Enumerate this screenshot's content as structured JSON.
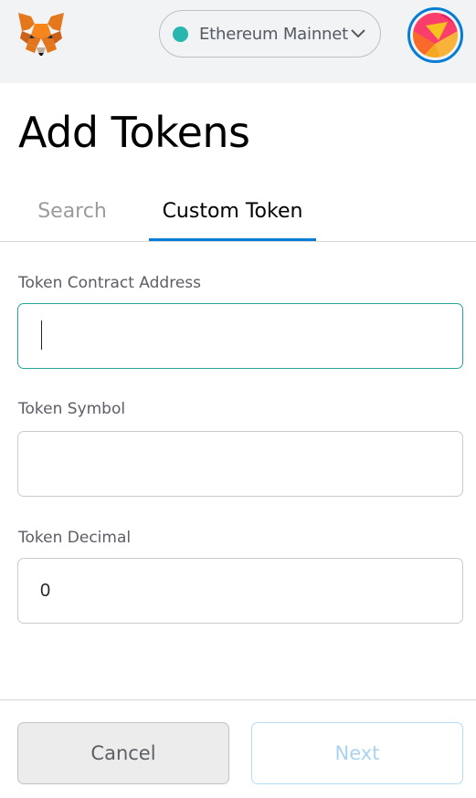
{
  "header": {
    "logo_icon": "metamask-fox-icon",
    "network": {
      "label": "Ethereum Mainnet",
      "dot_color": "#29b6af",
      "chevron_icon": "chevron-down-icon"
    },
    "avatar_icon": "account-identicon",
    "accent_color": "#037dd6"
  },
  "page": {
    "title": "Add Tokens"
  },
  "tabs": [
    {
      "label": "Search",
      "active": false
    },
    {
      "label": "Custom Token",
      "active": true
    }
  ],
  "form": {
    "contract_address": {
      "label": "Token Contract Address",
      "value": ""
    },
    "symbol": {
      "label": "Token Symbol",
      "value": ""
    },
    "decimal": {
      "label": "Token Decimal",
      "value": "0"
    }
  },
  "footer": {
    "cancel_label": "Cancel",
    "next_label": "Next"
  }
}
